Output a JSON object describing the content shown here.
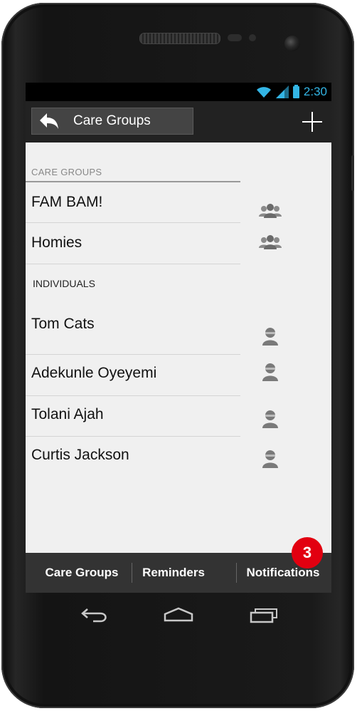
{
  "status_bar": {
    "time": "2:30",
    "icons": [
      "wifi-icon",
      "signal-icon",
      "battery-icon"
    ]
  },
  "action_bar": {
    "back_icon": "back-arrow-icon",
    "title": "Care Groups",
    "add_icon": "plus-icon"
  },
  "care_groups": {
    "header": "CARE GROUPS",
    "items": [
      {
        "name": "FAM BAM!",
        "icon": "group-icon"
      },
      {
        "name": "Homies",
        "icon": "group-icon"
      }
    ]
  },
  "individuals": {
    "header": "INDIVIDUALS",
    "items": [
      {
        "name": "Tom Cats",
        "icon": "person-icon"
      },
      {
        "name": "Adekunle Oyeyemi",
        "icon": "person-icon"
      },
      {
        "name": "Tolani Ajah",
        "icon": "person-icon"
      },
      {
        "name": "Curtis Jackson",
        "icon": "person-icon"
      }
    ]
  },
  "tabs": [
    {
      "label": "Care Groups"
    },
    {
      "label": "Reminders"
    },
    {
      "label": "Notifications",
      "badge": "3"
    }
  ],
  "colors": {
    "accent": "#33b5e5",
    "badge": "#e20010",
    "action_bar": "#222222",
    "content_bg": "#f0f0f0"
  },
  "nav_buttons": [
    "back-nav-icon",
    "home-nav-icon",
    "recent-apps-icon"
  ]
}
